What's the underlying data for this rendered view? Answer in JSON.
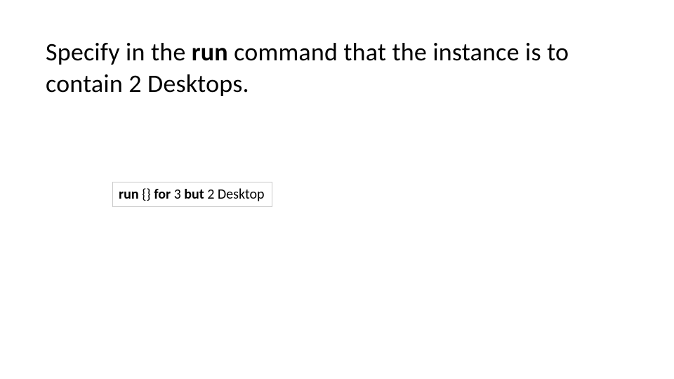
{
  "title": {
    "part1": "Specify in the ",
    "bold1": "run",
    "part2": " command that the instance is to contain 2 Desktops."
  },
  "code": {
    "seg1": "run",
    "seg2": " {} ",
    "seg3": "for",
    "seg4": " 3 ",
    "seg5": "but",
    "seg6": " 2 Desktop"
  }
}
